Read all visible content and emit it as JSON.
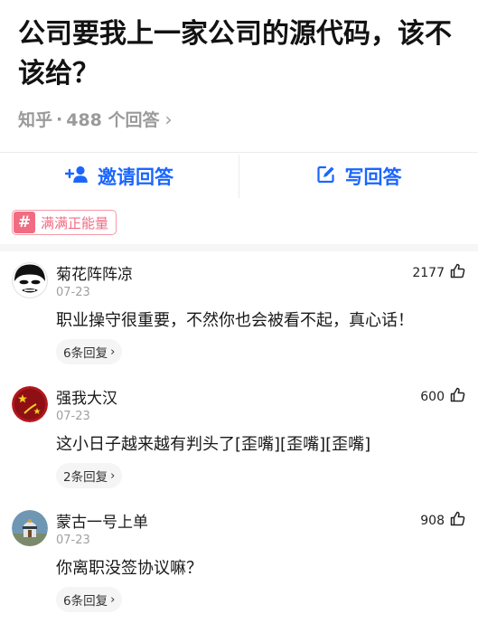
{
  "question": {
    "title": "公司要我上一家公司的源代码，该不该给？",
    "source": "知乎",
    "separator": "·",
    "answer_count": "488 个回答"
  },
  "actions": {
    "invite_label": "邀请回答",
    "write_label": "写回答"
  },
  "topic_tag": {
    "symbol": "#",
    "label": "满满正能量"
  },
  "comments": [
    {
      "username": "菊花阵阵凉",
      "date": "07-23",
      "likes": "2177",
      "text": "职业操守很重要，不然你也会被看不起，真心话！",
      "replies": "6条回复"
    },
    {
      "username": "强我大汉",
      "date": "07-23",
      "likes": "600",
      "text": "这小日子越来越有判头了[歪嘴][歪嘴][歪嘴]",
      "replies": "2条回复"
    },
    {
      "username": "蒙古一号上单",
      "date": "07-23",
      "likes": "908",
      "text": "你离职没签协议嘛？",
      "replies": "6条回复"
    }
  ],
  "colors": {
    "accent": "#1a66ff",
    "tag_pink": "#f06c83",
    "muted": "#9a9a9a"
  }
}
